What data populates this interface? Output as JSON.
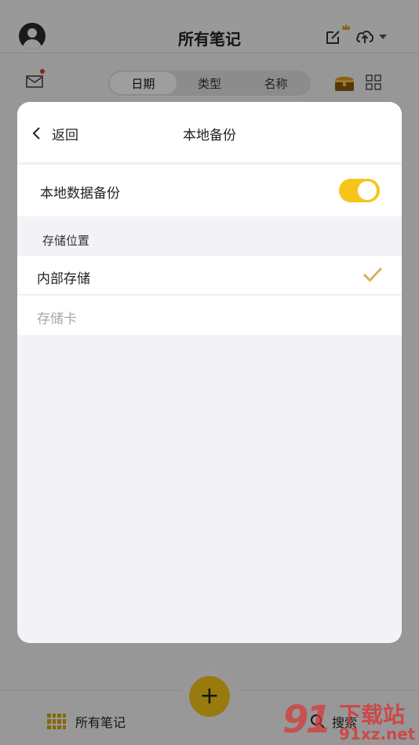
{
  "app": {
    "title": "所有笔记",
    "segments": [
      "日期",
      "类型",
      "名称"
    ],
    "selected_segment": "日期"
  },
  "bottom_nav": {
    "notes_label": "所有笔记",
    "search_label": "搜索"
  },
  "modal": {
    "back_label": "返回",
    "title": "本地备份",
    "toggle_label": "本地数据备份",
    "toggle_on": true,
    "section_label": "存储位置",
    "options": [
      {
        "label": "内部存储",
        "selected": true
      },
      {
        "label": "存储卡",
        "selected": false
      }
    ]
  },
  "watermark": {
    "logo": "91",
    "text": "下载站",
    "url": "91xz.net"
  },
  "colors": {
    "accent": "#f5c518",
    "check": "#d4b45a",
    "disabled_text": "#a8a8a8"
  },
  "icons": [
    "avatar",
    "edit-icon",
    "crown-icon",
    "cloud-upload-icon",
    "caret-down-icon",
    "mail-icon",
    "chest-icon",
    "grid-view-icon",
    "chevron-left-icon",
    "check-icon",
    "apps-icon",
    "search-icon",
    "plus-icon"
  ]
}
